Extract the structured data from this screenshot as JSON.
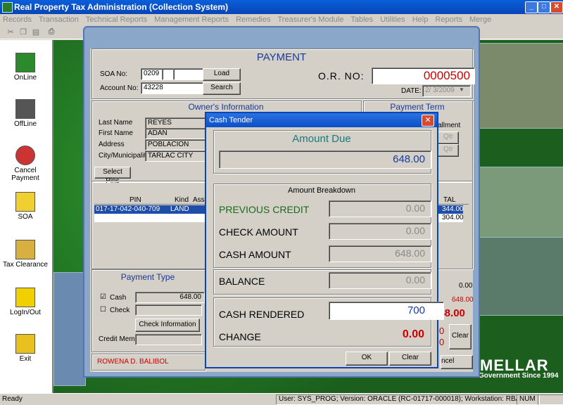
{
  "app": {
    "title": "Real Property Tax Administration (Collection System)",
    "win_buttons": {
      "minimize": "_",
      "maximize": "□",
      "close": "✕"
    }
  },
  "menu": [
    "Records",
    "Transaction",
    "Technical Reports",
    "Management Reports",
    "Remedies",
    "Treasurer's Module",
    "Tables",
    "Utilities",
    "Help",
    "Reports",
    "Merge"
  ],
  "sidebar": [
    {
      "label": "OnLine",
      "icon": "online-icon"
    },
    {
      "label": "OffLine",
      "icon": "offline-icon"
    },
    {
      "label": "Cancel Payment",
      "icon": "cancel-payment-icon"
    },
    {
      "label": "SOA",
      "icon": "soa-icon"
    },
    {
      "label": "Tax Clearance",
      "icon": "tax-clearance-icon"
    },
    {
      "label": "LogIn/Out",
      "icon": "login-icon"
    },
    {
      "label": "Exit",
      "icon": "exit-icon"
    }
  ],
  "payment": {
    "title": "PAYMENT",
    "soa_label": "SOA No:",
    "soa_value": "0209",
    "account_label": "Account No:",
    "account_value": "43228",
    "load_btn": "Load",
    "search_btn": "Search",
    "or_label": "O.R. NO:",
    "or_value": "0000500",
    "date_label": "DATE:",
    "date_value": "2/ 3/2009",
    "owner_title": "Owner's Information",
    "last_name_label": "Last Name",
    "last_name": "REYES",
    "first_name_label": "First Name",
    "first_name": "ADAN",
    "address_label": "Address",
    "address": "POBLACION",
    "city_label": "City/Municipality",
    "city": "TARLAC CITY",
    "payment_term_title": "Payment Term",
    "installment_label": "allment",
    "qtr1": "Qtr",
    "qtr2": "Qtr",
    "select_pins_btn": "Select Pins",
    "table_headers": {
      "pin": "PIN",
      "kind": "Kind",
      "assess": "Asses",
      "total": "TAL"
    },
    "table_row": {
      "pin": "017-17-042-040-709",
      "kind": "LAND"
    },
    "totals": [
      "344.00",
      "304.00"
    ],
    "payment_type_title": "Payment Type",
    "cash_label": "Cash",
    "cash_amount": "648.00",
    "check_label": "Check",
    "check_info_btn": "Check Information",
    "credit_memo_label": "Credit Memo",
    "cashier_name": "ROWENA D. BALIBOL",
    "right_value_1": "0.00",
    "right_value_2": "648.00",
    "right_big": "648.00",
    "clear_btn": "Clear",
    "cancel_partial": "ncel"
  },
  "cash_tender": {
    "title": "Cash Tender",
    "amount_due_title": "Amount Due",
    "amount_due": "648.00",
    "breakdown_title": "Amount Breakdown",
    "previous_credit_label": "PREVIOUS CREDIT",
    "previous_credit": "0.00",
    "check_amount_label": "CHECK AMOUNT",
    "check_amount": "0.00",
    "cash_amount_label": "CASH AMOUNT",
    "cash_amount": "648.00",
    "balance_label": "BALANCE",
    "balance": "0.00",
    "cash_rendered_label": "CASH RENDERED",
    "cash_rendered": "700",
    "change_label": "CHANGE",
    "change": "0.00",
    "ok_btn": "OK",
    "clear_btn": "Clear"
  },
  "desktop": {
    "brand": "MELLAR",
    "tagline": "Government Since 1994"
  },
  "status": {
    "ready": "Ready",
    "info": "User: SYS_PROG; Version: ORACLE (RC-01717-000018); Workstation: RBALIBOL",
    "num": "NUM"
  },
  "colors": {
    "accent_blue": "#1a3a9a",
    "teal": "#1a7a7a",
    "red": "#cc0000",
    "green_label": "#1a6a1a"
  }
}
